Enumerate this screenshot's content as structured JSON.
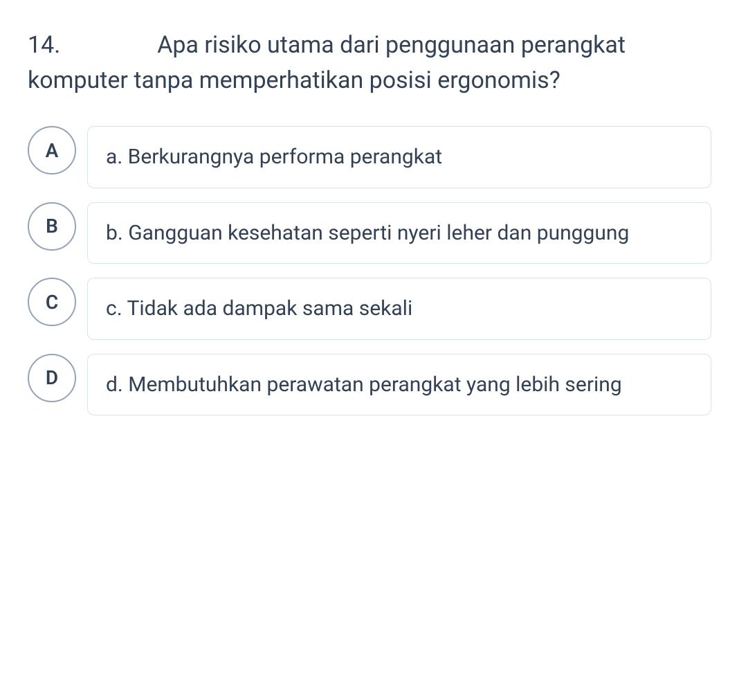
{
  "question": {
    "number": "14.",
    "text": "Apa risiko utama dari penggunaan perangkat komputer tanpa memperhatikan posisi ergonomis?"
  },
  "options": [
    {
      "letter": "A",
      "text": "a. Berkurangnya performa perangkat"
    },
    {
      "letter": "B",
      "text": "b. Gangguan kesehatan seperti nyeri leher dan punggung"
    },
    {
      "letter": "C",
      "text": "c. Tidak ada dampak sama sekali"
    },
    {
      "letter": "D",
      "text": "d. Membutuhkan perawatan perangkat yang lebih sering"
    }
  ]
}
